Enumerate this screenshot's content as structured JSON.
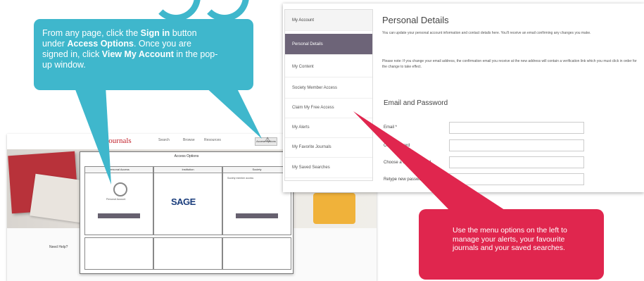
{
  "colors": {
    "teal_callout": "#3fb7cc",
    "pink_callout": "#e0264e",
    "menu_active": "#6d6478",
    "brand_red": "#c2222c"
  },
  "callout_teal": {
    "t1": "From any page, click the ",
    "b1": "Sign in",
    "t2": " button under ",
    "b2": "Access Options",
    "t3": ". Once you are signed in, click ",
    "b3": "View My Account",
    "t4": " in the pop-up window."
  },
  "callout_pink": {
    "text": "Use the menu options on the left to manage your alerts, your favourite journals and your saved searches."
  },
  "account_panel": {
    "menu_header": "My Account",
    "menu_items": [
      "Personal Details",
      "My Content",
      "Society Member Access",
      "Claim My Free Access",
      "My Alerts",
      "My Favorite Journals",
      "My Saved Searches"
    ],
    "title": "Personal Details",
    "intro": "You can update your personal account information and contact details here. You'll receive an email confirming any changes you make.",
    "note": "Please note: If you change your email address, the confirmation email you receive at the new address will contain a verification link which you must click in order for the change to take effect.",
    "section_title": "Email and Password",
    "fields": [
      {
        "label": "Email *",
        "value": ""
      },
      {
        "label": "Old Password",
        "value": ""
      },
      {
        "label": "Choose a New Password",
        "value": ""
      },
      {
        "label": "Retype new password",
        "value": ""
      }
    ]
  },
  "site": {
    "logo": "Journals",
    "nav": [
      "Search",
      "Browse",
      "Resources",
      "Access Options"
    ],
    "popup": {
      "title": "Access Options",
      "col_headers": [
        "Personal Access",
        "Institution",
        "Society"
      ],
      "user_name": "Personal Account",
      "publisher": "SAGE",
      "society_text": "Society member access",
      "bottom_label": "Need Help?"
    }
  }
}
